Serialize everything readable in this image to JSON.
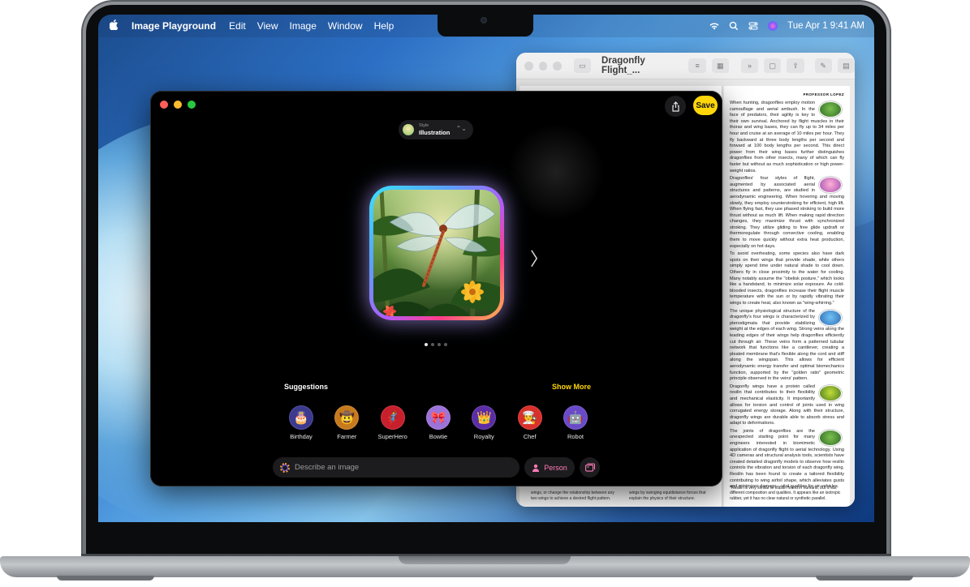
{
  "menubar": {
    "app_name": "Image Playground",
    "items": [
      "Edit",
      "View",
      "Image",
      "Window",
      "Help"
    ],
    "datetime": "Tue Apr 1  9:41 AM"
  },
  "pages": {
    "title": "Dragonfly Flight_...",
    "header": "PROFESSOR LOPEZ",
    "paragraphs": [
      "When hunting, dragonflies employ motion camouflage and aerial ambush. In the face of predators, their agility is key to their own survival. Anchored by flight muscles in their thorax and wing bases, they can fly up to 34 miles per hour and cruise at an average of 10 miles per hour. They fly backward at three body lengths per second and forward at 100 body lengths per second. This direct power from their wing bases further distinguishes dragonflies from other insects, many of which can fly faster but without as much sophistication or high power-weight ratios.",
      "Dragonflies' four styles of flight, augmented by associated aerial structures and patterns, are studied in aerodynamic engineering. When hovering and moving slowly, they employ counterstroking for efficient, high lift. When flying fast, they use phased stroking to build more thrust without as much lift. When making rapid direction changes, they maximize thrust with synchronized stroking. They utilize gliding to free glide updraft or thermoregulate through convective cooling, enabling them to move quickly without extra heat production, especially on hot days.",
      "To avoid overheating, some species also have dark spots on their wings that provide shade, while others simply spend time under natural shade to cool down. Others fly in close proximity to the water for cooling. Many notably assume the \"obelisk posture,\" which looks like a handstand, to minimize solar exposure. As cold-blooded insects, dragonflies increase their flight muscle temperature with the sun or by rapidly vibrating their wings to create heat, also known as \"wing-whirring.\"",
      "The unique physiological structure of the dragonfly's four wings is characterized by pterostigmata that provide stabilizing weight at the edges of each wing. Strong veins along the leading edges of their wings help dragonflies efficiently cut through air. These veins form a patterned tubular network that functions like a cantilever, creating a pleated membrane that's flexible along the cord and stiff along the wingspan. This allows for efficient aerodynamic energy transfer and optimal biomechanics function, supported by the \"golden ratio\" geometric principle observed in the veins' pattern.",
      "Dragonfly wings have a protein called resilin that contributes to their flexibility and mechanical elasticity. It importantly allows for torsion and control of joints used in wing corrugated energy storage. Along with their structure, dragonfly wings are durable able to absorb stress and adapt to deformations.",
      "The joints of dragonflies are the unexpected starting point for many engineers interested in biomimetic application of dragonfly flight to aerial technology. Using 4D cameras and structural analysis tools, scientists have created detailed dragonfly models to observe how resilin controls the vibration and torsion of each dragonfly wing. Resilin has been found to create a tailored flexibility contributing to wing airfoil shape, which alleviates gusts and minimizes damage—vital qualities for air vehicles."
    ],
    "footnote": "*Resilin is very similar to elastin found in humans, but it has different composition and qualities. It appears like an isotropic rubber, yet it has no clear natural or synthetic parallel.",
    "left_footer": [
      "wings, or change the relationship between any two wings to achieve a desired flight pattern.",
      "wings by swinging equidistance forces that explain the physics of their structure."
    ]
  },
  "playground": {
    "save_label": "Save",
    "style": {
      "label": "Style",
      "value": "Illustration"
    },
    "page_count": 4,
    "active_page": 1,
    "suggestions_title": "Suggestions",
    "show_more_label": "Show More",
    "suggestions": [
      {
        "label": "Birthday",
        "icon": "birthday-cake-icon",
        "glyph": "🎂",
        "color": "#3b3a8f"
      },
      {
        "label": "Farmer",
        "icon": "farmer-hat-icon",
        "glyph": "🤠",
        "color": "#c67a1e"
      },
      {
        "label": "SuperHero",
        "icon": "superhero-mask-icon",
        "glyph": "🦸",
        "color": "#c81f2d"
      },
      {
        "label": "Bowtie",
        "icon": "bowtie-icon",
        "glyph": "🎀",
        "color": "#9b73d9"
      },
      {
        "label": "Royalty",
        "icon": "scepter-icon",
        "glyph": "👑",
        "color": "#5b2ea6"
      },
      {
        "label": "Chef",
        "icon": "chef-hat-icon",
        "glyph": "👨‍🍳",
        "color": "#d8302b"
      },
      {
        "label": "Robot",
        "icon": "robot-icon",
        "glyph": "🤖",
        "color": "#6a4ac8"
      }
    ],
    "describe_placeholder": "Describe an image",
    "person_label": "Person"
  },
  "colors": {
    "accent_yellow": "#ffd60a",
    "person_pink": "#ff7ab8"
  }
}
